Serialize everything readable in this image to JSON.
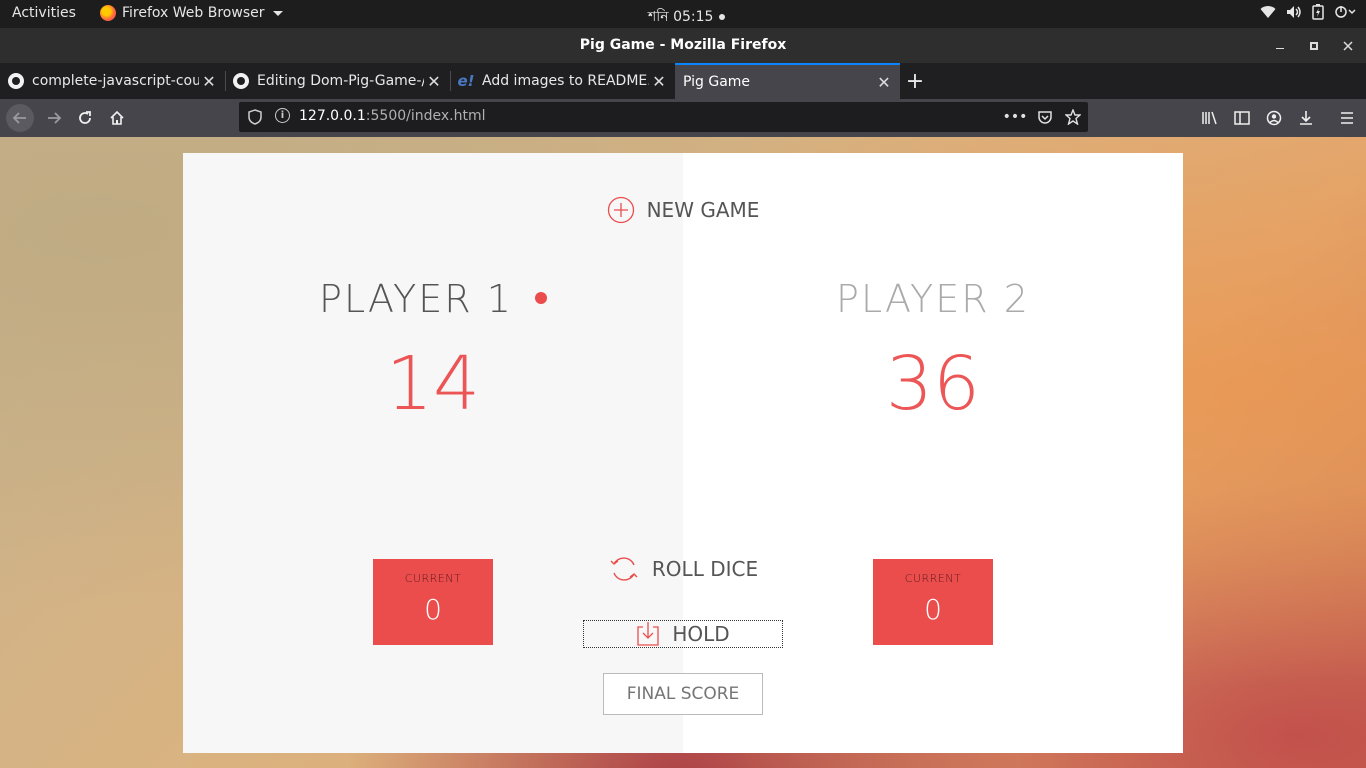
{
  "system": {
    "activities": "Activities",
    "app_name": "Firefox Web Browser",
    "clock": "শনি 05:15"
  },
  "window": {
    "title": "Pig Game - Mozilla Firefox"
  },
  "tabs": [
    {
      "label": "complete-javascript-cour",
      "icon": "github-icon"
    },
    {
      "label": "Editing Dom-Pig-Game-/",
      "icon": "github-icon"
    },
    {
      "label": "Add images to README.",
      "icon": "ezgif-icon"
    },
    {
      "label": "Pig Game",
      "icon": "none",
      "active": true
    }
  ],
  "urlbar": {
    "host": "127.0.0.1",
    "rest": ":5500/index.html"
  },
  "game": {
    "new_game": "NEW GAME",
    "roll_dice": "ROLL DICE",
    "hold": "HOLD",
    "final_score_placeholder": "FINAL SCORE",
    "players": [
      {
        "name": "PLAYER 1",
        "score": "14",
        "current_label": "CURRENT",
        "current": "0",
        "active": true
      },
      {
        "name": "PLAYER 2",
        "score": "36",
        "current_label": "CURRENT",
        "current": "0",
        "active": false
      }
    ]
  },
  "colors": {
    "accent": "#eb4d4d",
    "tab_active": "#45454b",
    "tab_indicator": "#0a84ff"
  }
}
